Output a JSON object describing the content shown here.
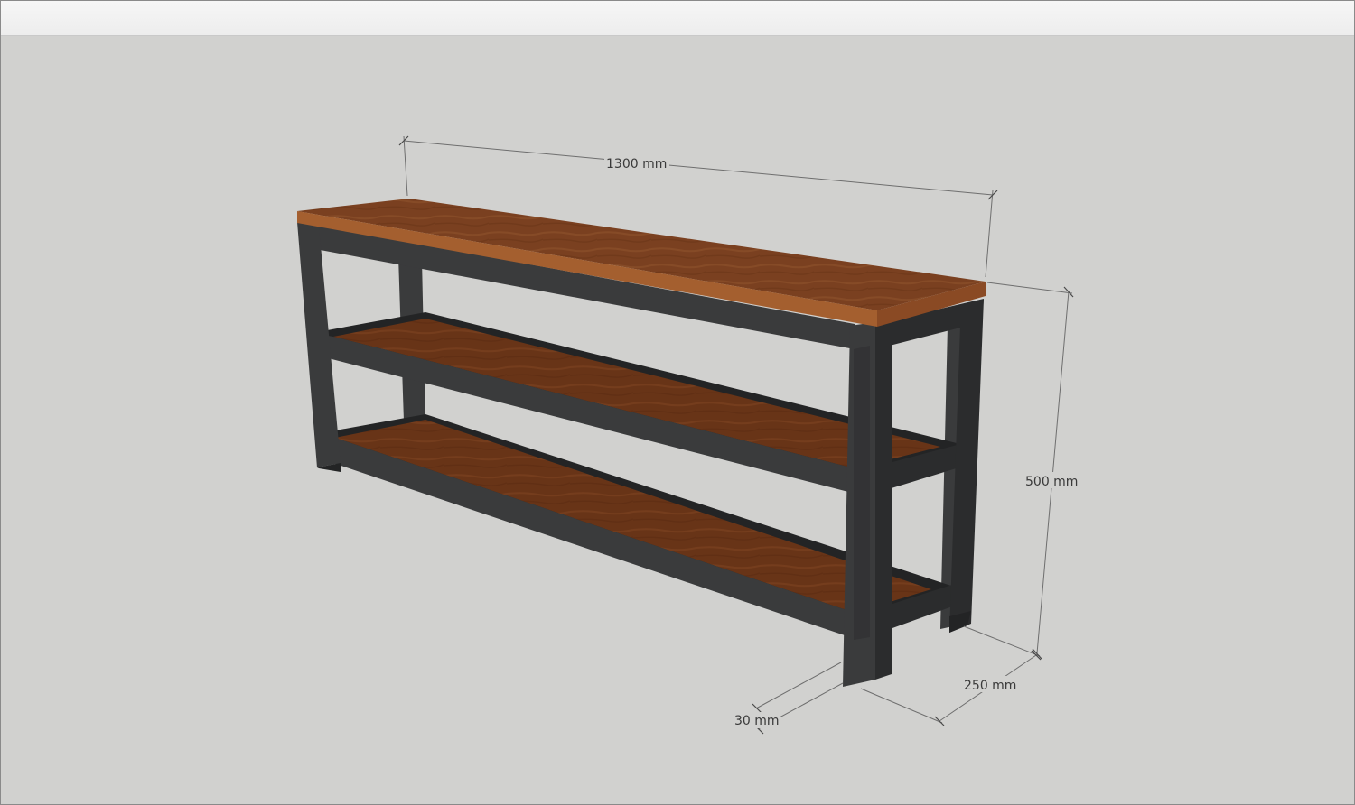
{
  "window": {
    "title": ""
  },
  "colors": {
    "background": "#d1d1cf",
    "steel": "#3a3b3c",
    "wood": "#8a4a24"
  },
  "dimensions": {
    "length": "1300 mm",
    "height": "500 mm",
    "depth": "250 mm",
    "tube": "30 mm"
  },
  "model": {
    "object": "shelf-console"
  }
}
